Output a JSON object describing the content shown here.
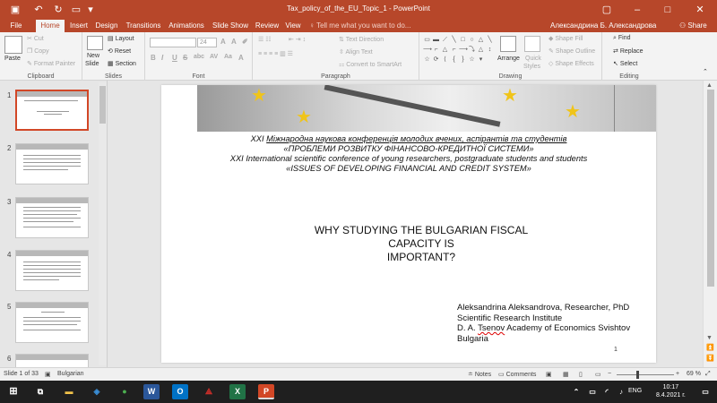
{
  "titlebar": {
    "doc_title": "Tax_policy_of_the_EU_Topic_1 - PowerPoint",
    "user": "Александрина Б. Александрова",
    "share": "Share",
    "tell_me": "Tell me what you want to do..."
  },
  "tabs": [
    "File",
    "Home",
    "Insert",
    "Design",
    "Transitions",
    "Animations",
    "Slide Show",
    "Review",
    "View"
  ],
  "ribbon": {
    "clipboard": {
      "label": "Clipboard",
      "paste": "Paste",
      "cut": "Cut",
      "copy": "Copy",
      "format_painter": "Format Painter"
    },
    "slides": {
      "label": "Slides",
      "new_slide_1": "New",
      "new_slide_2": "Slide",
      "layout": "Layout",
      "reset": "Reset",
      "section": "Section"
    },
    "font": {
      "label": "Font",
      "size": "24",
      "bold": "B",
      "italic": "I",
      "underline": "U",
      "strike": "S",
      "shadow": "abc",
      "spacing": "AV",
      "case": "Aa"
    },
    "paragraph": {
      "label": "Paragraph",
      "text_direction": "Text Direction",
      "align_text": "Align Text",
      "smartart": "Convert to SmartArt"
    },
    "drawing": {
      "label": "Drawing",
      "arrange": "Arrange",
      "quick_styles_1": "Quick",
      "quick_styles_2": "Styles",
      "shape_fill": "Shape Fill",
      "shape_outline": "Shape Outline",
      "shape_effects": "Shape Effects"
    },
    "editing": {
      "label": "Editing",
      "find": "Find",
      "replace": "Replace",
      "select": "Select"
    }
  },
  "thumbnails": [
    {
      "num": "1"
    },
    {
      "num": "2"
    },
    {
      "num": "3"
    },
    {
      "num": "4"
    },
    {
      "num": "5"
    },
    {
      "num": "6"
    }
  ],
  "slide": {
    "line1_pre": "XXI ",
    "line1_main": "Міжнародна наукова конференція молодих вчених, аспірантів та студентів",
    "line2": "«ПРОБЛЕМИ РОЗВИТКУ ФІНАНСОВО-КРЕДИТНОЇ СИСТЕМИ»",
    "line3": "XXI International scientific conference of young researchers, postgraduate students and students",
    "line4": "«ISSUES OF DEVELOPING FINANCIAL AND CREDIT SYSTEM»",
    "question_1": "WHY STUDYING THE BULGARIAN FISCAL CAPACITY IS",
    "question_2": "IMPORTANT?",
    "author_1": "Aleksandrina Aleksandrova, Researcher, PhD",
    "author_2": "Scientific Research Institute",
    "author_3_pre": "D. A. ",
    "author_3_ul": "Tsenov",
    "author_3_post": " Academy of Economics Svishtov",
    "author_4": "Bulgaria",
    "page_number": "1"
  },
  "status": {
    "slide_of": "Slide 1 of 33",
    "language": "Bulgarian",
    "notes": "Notes",
    "comments": "Comments",
    "zoom": "69 %"
  },
  "taskbar": {
    "lang": "ENG",
    "time": "10:17",
    "date": "8.4.2021 г."
  },
  "colors": {
    "accent": "#b7472a",
    "selected": "#d24726"
  }
}
